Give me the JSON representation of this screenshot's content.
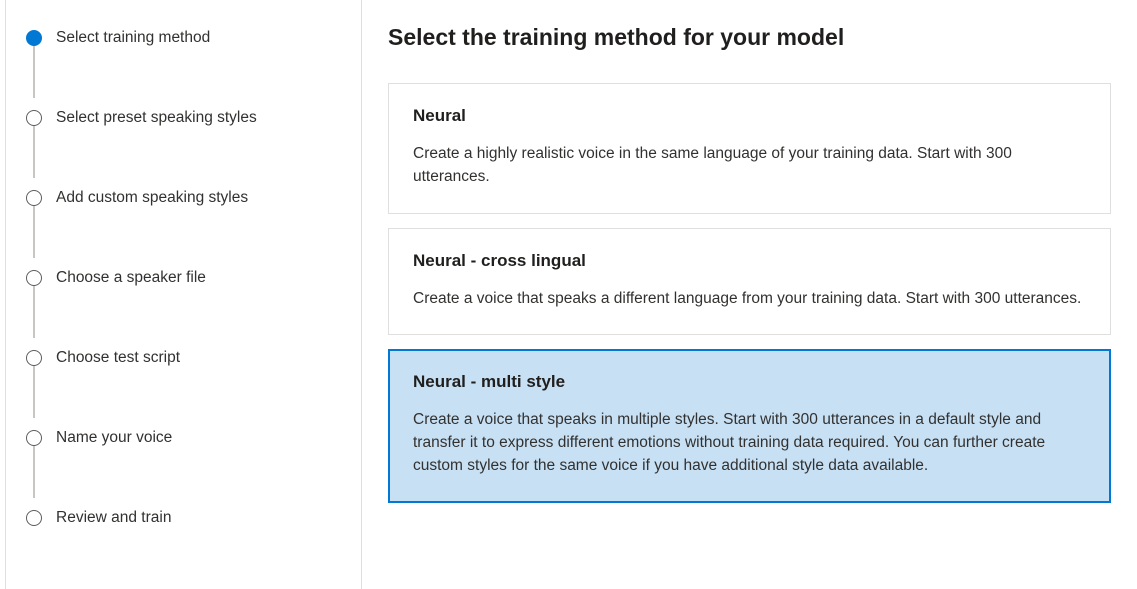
{
  "sidebar": {
    "steps": [
      {
        "label": "Select training method",
        "active": true
      },
      {
        "label": "Select preset speaking styles",
        "active": false
      },
      {
        "label": "Add custom speaking styles",
        "active": false
      },
      {
        "label": "Choose a speaker file",
        "active": false
      },
      {
        "label": "Choose test script",
        "active": false
      },
      {
        "label": "Name your voice",
        "active": false
      },
      {
        "label": "Review and train",
        "active": false
      }
    ]
  },
  "main": {
    "title": "Select the training method for your model",
    "options": [
      {
        "title": "Neural",
        "description": "Create a highly realistic voice in the same language of your training data. Start with 300 utterances.",
        "selected": false
      },
      {
        "title": "Neural - cross lingual",
        "description": "Create a voice that speaks a different language from your training data. Start with 300 utterances.",
        "selected": false
      },
      {
        "title": "Neural - multi style",
        "description": "Create a voice that speaks in multiple styles. Start with 300 utterances in a default style and transfer it to express different emotions without training data required. You can further create custom styles for the same voice if you have additional style data available.",
        "selected": true
      }
    ]
  }
}
